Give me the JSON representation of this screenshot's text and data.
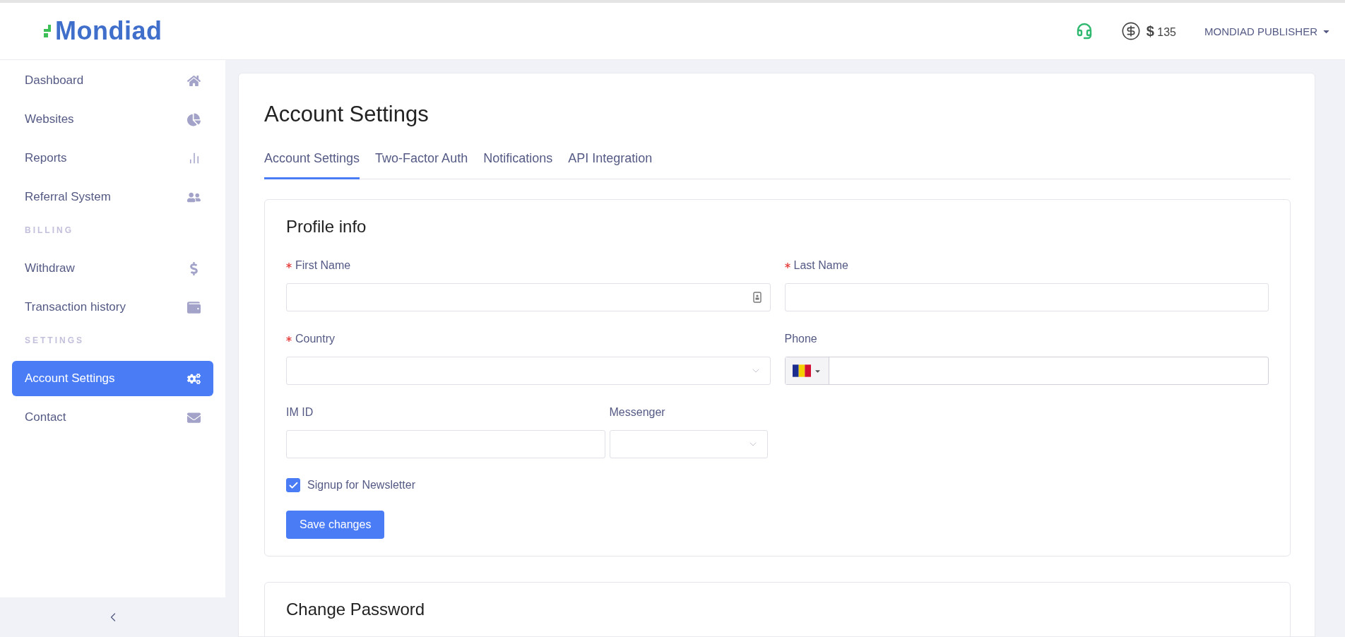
{
  "header": {
    "logo": "Mondiad",
    "currency": "$",
    "balance": "135",
    "user": "MONDIAD PUBLISHER"
  },
  "sidebar": {
    "items": [
      {
        "kind": "link",
        "label": "Dashboard",
        "selected": false
      },
      {
        "kind": "link",
        "label": "Websites",
        "selected": false
      },
      {
        "kind": "link",
        "label": "Reports",
        "selected": false
      },
      {
        "kind": "link",
        "label": "Referral System",
        "selected": false
      },
      {
        "kind": "section",
        "label": "BILLING"
      },
      {
        "kind": "link",
        "label": "Withdraw",
        "selected": false
      },
      {
        "kind": "link",
        "label": "Transaction history",
        "selected": false
      },
      {
        "kind": "section",
        "label": "SETTINGS"
      },
      {
        "kind": "link",
        "label": "Account Settings",
        "selected": true
      },
      {
        "kind": "link",
        "label": "Contact",
        "selected": false
      }
    ]
  },
  "page": {
    "title": "Account Settings",
    "tabs": [
      {
        "label": "Account Settings",
        "selected": true
      },
      {
        "label": "Two-Factor Auth",
        "selected": false
      },
      {
        "label": "Notifications",
        "selected": false
      },
      {
        "label": "API Integration",
        "selected": false
      }
    ],
    "profile": {
      "title": "Profile info",
      "rows": [
        {
          "kind": "split",
          "fields": [
            {
              "label": "First Name",
              "required": true,
              "kind": "contact"
            },
            {
              "label": "Last Name",
              "required": true,
              "kind": "text"
            }
          ]
        },
        {
          "kind": "split",
          "fields": [
            {
              "label": "Country",
              "required": true,
              "kind": "select"
            },
            {
              "label": "Phone",
              "required": false,
              "kind": "phone"
            }
          ]
        },
        {
          "kind": "half",
          "fields": [
            {
              "label": "IM ID",
              "required": false,
              "kind": "text"
            },
            {
              "label": "Messenger",
              "required": false,
              "kind": "select"
            }
          ]
        }
      ],
      "newsletter": {
        "label": "Signup for Newsletter",
        "checked": true
      },
      "save": "Save changes"
    },
    "password": {
      "title": "Change Password"
    }
  }
}
